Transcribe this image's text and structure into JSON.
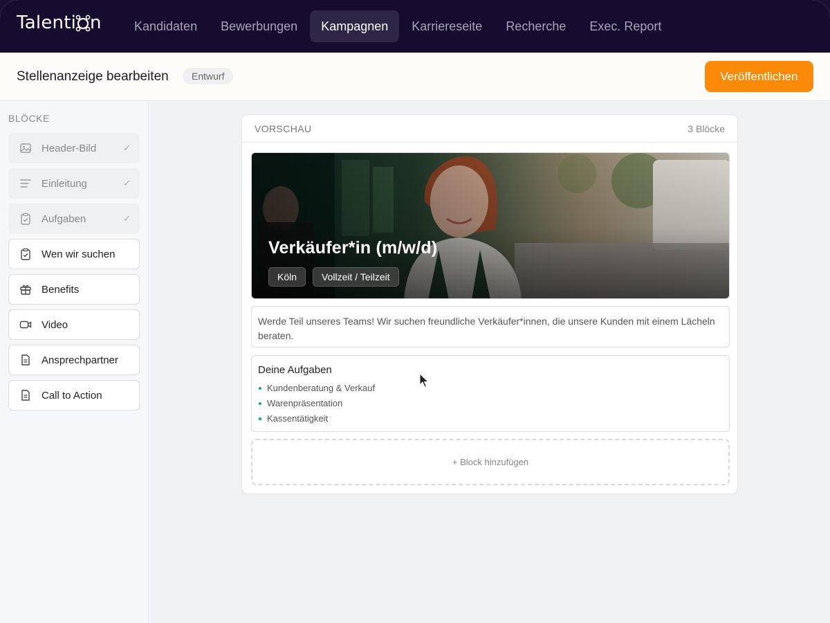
{
  "brand": {
    "name_part1": "Talenti",
    "name_part2": "n",
    "accent": "#fb8a08"
  },
  "nav": {
    "items": [
      {
        "label": "Kandidaten"
      },
      {
        "label": "Bewerbungen"
      },
      {
        "label": "Kampagnen",
        "active": true
      },
      {
        "label": "Karriereseite"
      },
      {
        "label": "Recherche"
      },
      {
        "label": "Exec. Report"
      }
    ]
  },
  "header": {
    "title": "Stellenanzeige bearbeiten",
    "status": "Entwurf",
    "publish_label": "Veröffentlichen"
  },
  "sidebar": {
    "heading": "BLÖCKE",
    "items": [
      {
        "label": "Header-Bild",
        "icon": "image-icon",
        "used": true,
        "check": "✓"
      },
      {
        "label": "Einleitung",
        "icon": "text-lines-icon",
        "used": true,
        "check": "✓"
      },
      {
        "label": "Aufgaben",
        "icon": "clipboard-check-icon",
        "used": true,
        "check": "✓"
      },
      {
        "label": "Wen wir suchen",
        "icon": "clipboard-check-icon",
        "used": false
      },
      {
        "label": "Benefits",
        "icon": "gift-icon",
        "used": false
      },
      {
        "label": "Video",
        "icon": "video-icon",
        "used": false
      },
      {
        "label": "Ansprechpartner",
        "icon": "document-icon",
        "used": false
      },
      {
        "label": "Call to Action",
        "icon": "document-icon",
        "used": false
      }
    ]
  },
  "preview": {
    "label": "VORSCHAU",
    "count": "3 Blöcke",
    "hero": {
      "title": "Verkäufer*in (m/w/d)",
      "tags": [
        "Köln",
        "Vollzeit / Teilzeit"
      ]
    },
    "intro": "Werde Teil unseres Teams! Wir suchen freundliche Verkäufer*innen, die unsere Kunden mit einem Lächeln beraten.",
    "tasks": {
      "title": "Deine Aufgaben",
      "items": [
        "Kundenberatung & Verkauf",
        "Warenpräsentation",
        "Kassentätigkeit"
      ]
    },
    "add_block_label": "+ Block hinzufügen"
  }
}
